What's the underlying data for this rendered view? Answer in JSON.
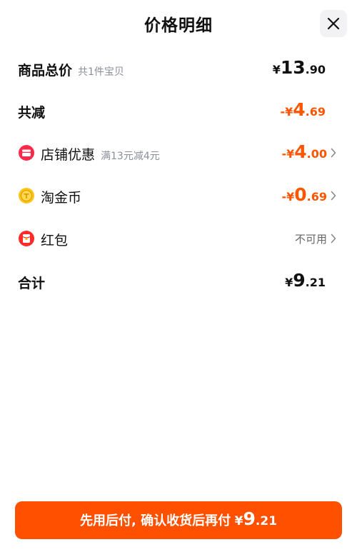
{
  "header": {
    "title": "价格明细",
    "close_icon": "close-icon"
  },
  "rows": {
    "total_goods": {
      "label": "商品总价",
      "sub": "共1件宝贝",
      "currency": "¥",
      "int": "13",
      "dec": ".90"
    },
    "total_reduce": {
      "label": "共减",
      "prefix": "-",
      "currency": "¥",
      "int": "4",
      "dec": ".69"
    },
    "shop_discount": {
      "label": "店铺优惠",
      "sub": "满13元减4元",
      "prefix": "-",
      "currency": "¥",
      "int": "4",
      "dec": ".00",
      "icon": "shop-discount-icon"
    },
    "taojinbi": {
      "label": "淘金币",
      "prefix": "-",
      "currency": "¥",
      "int": "0",
      "dec": ".69",
      "icon": "coin-icon"
    },
    "red_packet": {
      "label": "红包",
      "status": "不可用",
      "icon": "red-packet-icon"
    },
    "grand_total": {
      "label": "合计",
      "currency": "¥",
      "int": "9",
      "dec": ".21"
    }
  },
  "cta": {
    "text": "先用后付, 确认收货后再付",
    "currency": "¥",
    "int": "9",
    "dec": ".21"
  },
  "colors": {
    "accent": "#ff5000",
    "discount": "#ff5500",
    "secondary_text": "#8a8f99"
  }
}
